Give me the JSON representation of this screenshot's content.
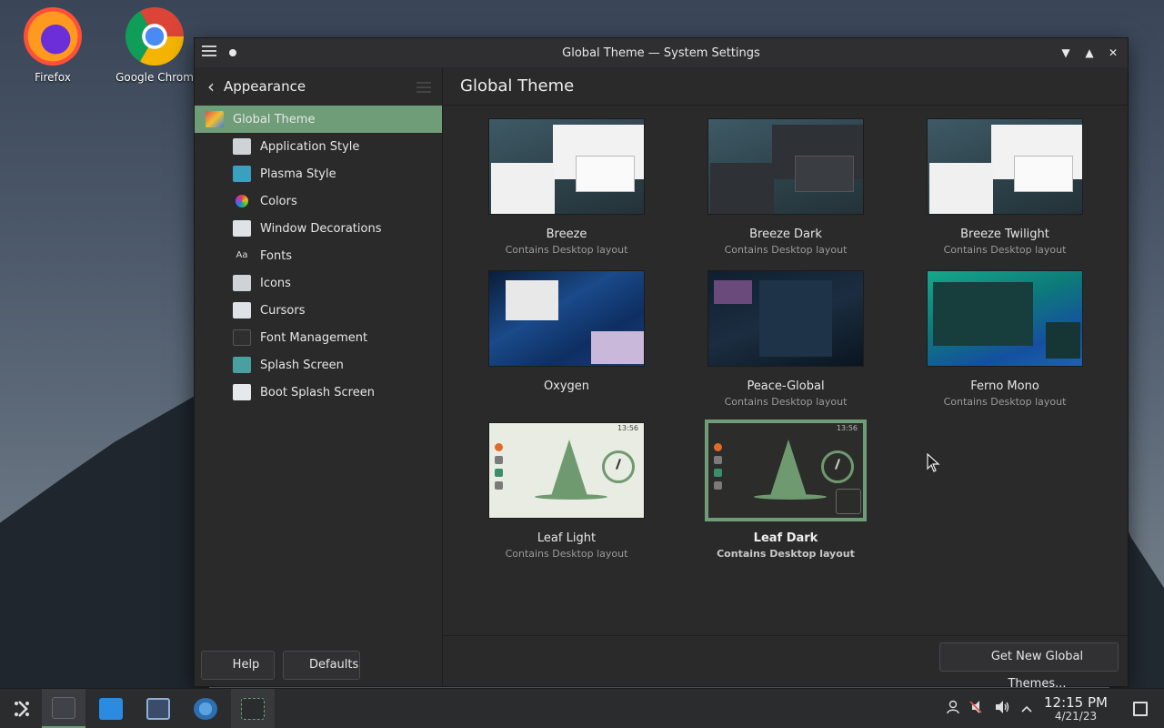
{
  "desktop": {
    "icons": [
      {
        "label": "Firefox"
      },
      {
        "label": "Google Chrom"
      }
    ]
  },
  "window": {
    "title": "Global Theme — System Settings",
    "controls": {
      "minimize": "▼",
      "maximize": "▲",
      "close": "✕"
    }
  },
  "sidebar": {
    "header": "Appearance",
    "items": [
      {
        "label": "Global Theme",
        "active": true,
        "icon_color": "#d94b6b"
      },
      {
        "label": "Application Style",
        "icon_color": "#cfd3d8"
      },
      {
        "label": "Plasma Style",
        "icon_color": "#3ba0c0"
      },
      {
        "label": "Colors",
        "icon_color": "#e0a020"
      },
      {
        "label": "Window Decorations",
        "icon_color": "#dfe3e8"
      },
      {
        "label": "Fonts",
        "icon_color": "#2a2a2b"
      },
      {
        "label": "Icons",
        "icon_color": "#cfd3d8"
      },
      {
        "label": "Cursors",
        "icon_color": "#dfe3e8"
      },
      {
        "label": "Font Management",
        "icon_color": "#2f2f30"
      },
      {
        "label": "Splash Screen",
        "icon_color": "#4aa0a0"
      },
      {
        "label": "Boot Splash Screen",
        "icon_color": "#e6e9ec"
      }
    ],
    "fonts_icon_text": "Aa"
  },
  "content": {
    "title": "Global Theme",
    "themes": [
      {
        "name": "Breeze",
        "subtitle": "Contains Desktop layout",
        "style": "breeze"
      },
      {
        "name": "Breeze Dark",
        "subtitle": "Contains Desktop layout",
        "style": "dark"
      },
      {
        "name": "Breeze Twilight",
        "subtitle": "Contains Desktop layout",
        "style": "breeze"
      },
      {
        "name": "Oxygen",
        "subtitle": "",
        "style": "oxygen"
      },
      {
        "name": "Peace-Global",
        "subtitle": "Contains Desktop layout",
        "style": "peace"
      },
      {
        "name": "Ferno Mono",
        "subtitle": "Contains Desktop layout",
        "style": "ferno"
      },
      {
        "name": "Leaf Light",
        "subtitle": "Contains Desktop layout",
        "style": "leaf",
        "clock": "13:56"
      },
      {
        "name": "Leaf Dark",
        "subtitle": "Contains Desktop layout",
        "style": "leafdark",
        "clock": "13:56",
        "selected": true
      }
    ],
    "get_new_label": "Get New Global Themes...",
    "help_label": "Help",
    "defaults_label": "Defaults"
  },
  "taskbar": {
    "clock_time": "12:15 PM",
    "clock_date": "4/21/23"
  },
  "colors": {
    "accent": "#6e9d78"
  }
}
